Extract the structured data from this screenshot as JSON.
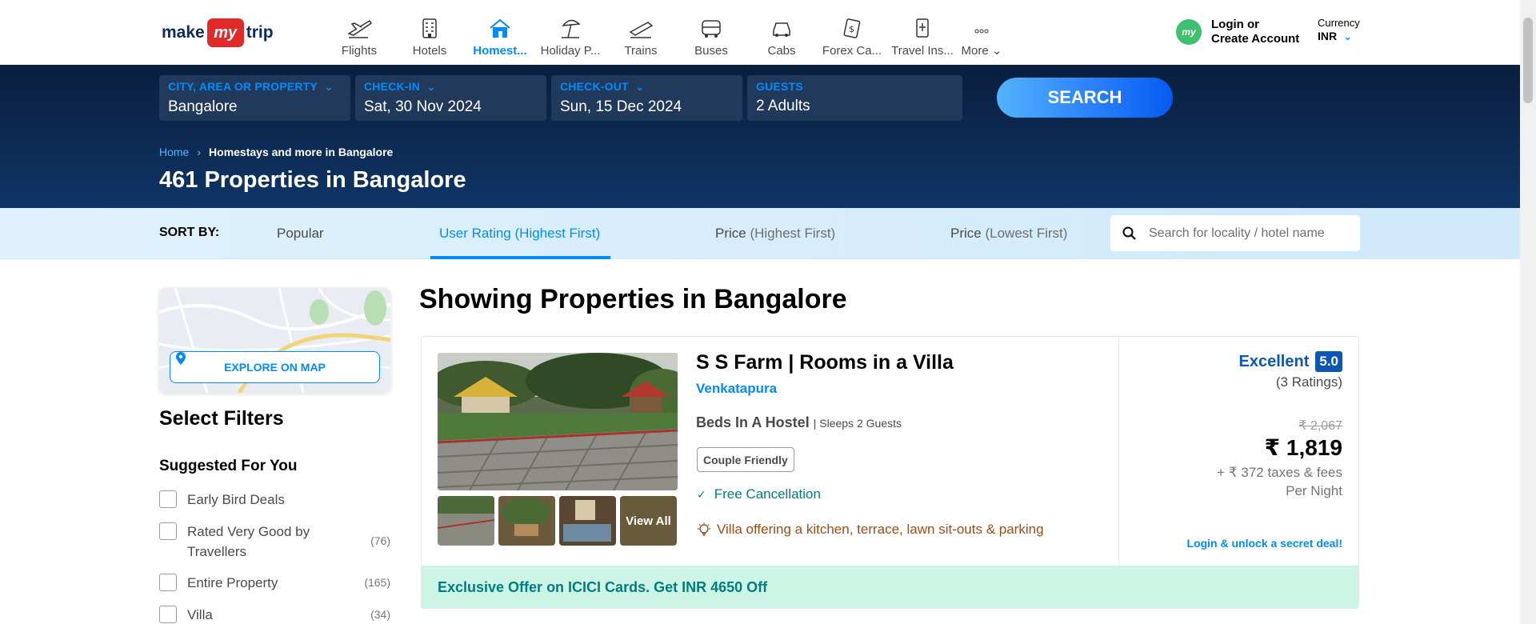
{
  "header": {
    "logo": {
      "make": "make",
      "my": "my",
      "trip": "trip"
    },
    "nav": [
      {
        "label": "Flights",
        "icon": "flight-icon",
        "active": false
      },
      {
        "label": "Hotels",
        "icon": "hotel-icon",
        "active": false
      },
      {
        "label": "Homest...",
        "icon": "homestay-icon",
        "active": true
      },
      {
        "label": "Holiday P...",
        "icon": "holiday-icon",
        "active": false
      },
      {
        "label": "Trains",
        "icon": "train-icon",
        "active": false
      },
      {
        "label": "Buses",
        "icon": "bus-icon",
        "active": false
      },
      {
        "label": "Cabs",
        "icon": "cab-icon",
        "active": false
      },
      {
        "label": "Forex Ca...",
        "icon": "forex-icon",
        "active": false
      },
      {
        "label": "Travel Ins...",
        "icon": "insurance-icon",
        "active": false
      }
    ],
    "more_label": "More",
    "login": {
      "avatar": "my",
      "line1": "Login or",
      "line2": "Create Account"
    },
    "currency": {
      "label": "Currency",
      "value": "INR"
    }
  },
  "search": {
    "city": {
      "label": "CITY, AREA OR PROPERTY",
      "value": "Bangalore"
    },
    "checkin": {
      "label": "CHECK-IN",
      "value": "Sat, 30 Nov 2024"
    },
    "checkout": {
      "label": "CHECK-OUT",
      "value": "Sun, 15 Dec 2024"
    },
    "guests": {
      "label": "GUESTS",
      "value": "2 Adults"
    },
    "button": "SEARCH"
  },
  "breadcrumb": {
    "home": "Home",
    "current": "Homestays and more in Bangalore"
  },
  "results_title": "461 Properties in Bangalore",
  "sort": {
    "label": "SORT BY:",
    "options": [
      {
        "main": "Popular",
        "sub": ""
      },
      {
        "main": "User Rating",
        "sub": "(Highest First)"
      },
      {
        "main": "Price",
        "sub": "(Highest First)"
      },
      {
        "main": "Price",
        "sub": "(Lowest First)"
      }
    ],
    "active_index": 1,
    "locality_placeholder": "Search for locality / hotel name"
  },
  "sidebar": {
    "explore_map": "EXPLORE ON MAP",
    "select_filters": "Select Filters",
    "suggested_title": "Suggested For You",
    "filters": [
      {
        "name": "Early Bird Deals",
        "count": ""
      },
      {
        "name": "Rated Very Good by Travellers",
        "count": "(76)"
      },
      {
        "name": "Entire Property",
        "count": "(165)"
      },
      {
        "name": "Villa",
        "count": "(34)"
      }
    ]
  },
  "main": {
    "showing_title": "Showing Properties in Bangalore",
    "listing": {
      "name": "S S Farm | Rooms in a Villa",
      "location": "Venkatapura",
      "type": "Beds In A Hostel",
      "sleeps": "| Sleeps 2 Guests",
      "tag": "Couple Friendly",
      "free_cancellation": "Free Cancellation",
      "highlight": "Villa offering a kitchen, terrace, lawn sit-outs & parking",
      "view_all": "View All",
      "rating_word": "Excellent",
      "rating_score": "5.0",
      "rating_count": "(3 Ratings)",
      "original_price": "₹ 2,067",
      "price": "₹ 1,819",
      "taxes": "+ ₹ 372 taxes & fees",
      "per_night": "Per Night",
      "secret_deal": "Login & unlock a secret deal!",
      "offer": "Exclusive Offer on ICICI Cards. Get INR 4650 Off"
    }
  },
  "colors": {
    "accent": "#008cff",
    "band_dark": "#0a1e3d",
    "rating_blue": "#0b58b4",
    "offer_bg": "#ccf5e5",
    "offer_text": "#007e7d"
  }
}
